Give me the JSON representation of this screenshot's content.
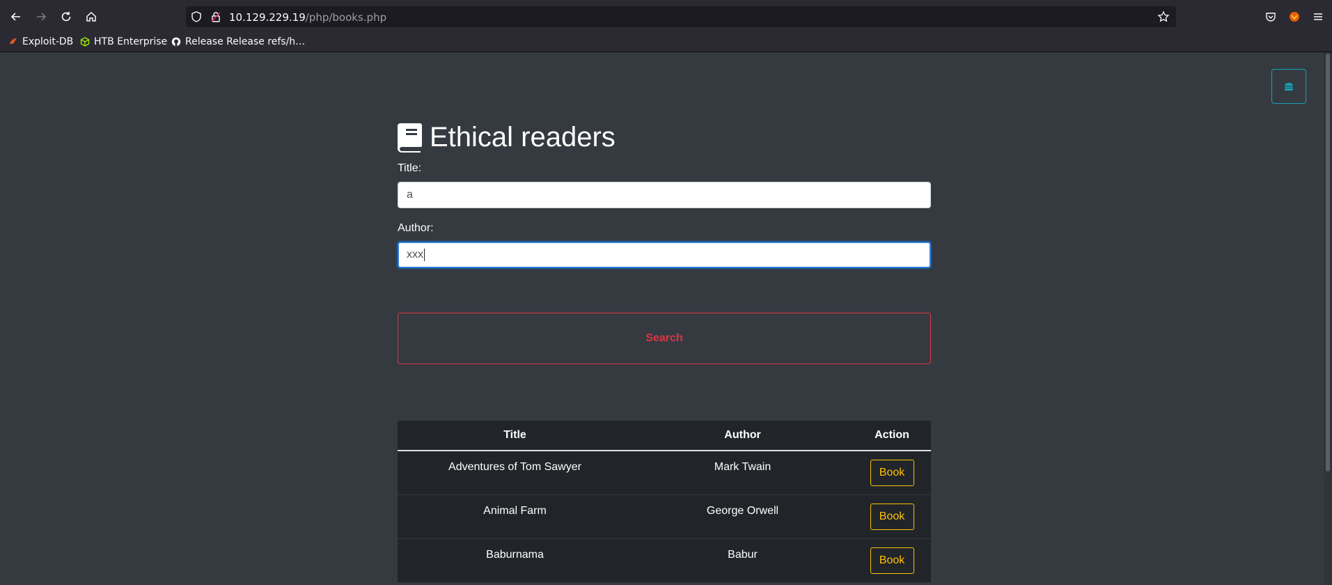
{
  "browser": {
    "url_host": "10.129.229.19",
    "url_path": "/php/books.php",
    "bookmarks": [
      {
        "label": "Exploit-DB",
        "icon": "exploitdb-icon",
        "color": "#e2571e"
      },
      {
        "label": "HTB Enterprise",
        "icon": "htb-cube-icon",
        "color": "#9fef00"
      },
      {
        "label": "Release Release refs/h…",
        "icon": "github-icon",
        "color": "#fbfbfe"
      }
    ]
  },
  "page": {
    "title": "Ethical readers",
    "form": {
      "title_label": "Title:",
      "title_value": "a",
      "author_label": "Author:",
      "author_value": "xxx",
      "search_label": "Search"
    },
    "table": {
      "headers": [
        "Title",
        "Author",
        "Action"
      ],
      "rows": [
        {
          "title": "Adventures of Tom Sawyer",
          "author": "Mark Twain",
          "action": "Book"
        },
        {
          "title": "Animal Farm",
          "author": "George Orwell",
          "action": "Book"
        },
        {
          "title": "Baburnama",
          "author": "Babur",
          "action": "Book"
        }
      ]
    }
  },
  "colors": {
    "page_bg": "#343a40",
    "table_bg": "#212529",
    "danger": "#dc3545",
    "warning": "#ffc107",
    "info": "#17a2b8"
  }
}
